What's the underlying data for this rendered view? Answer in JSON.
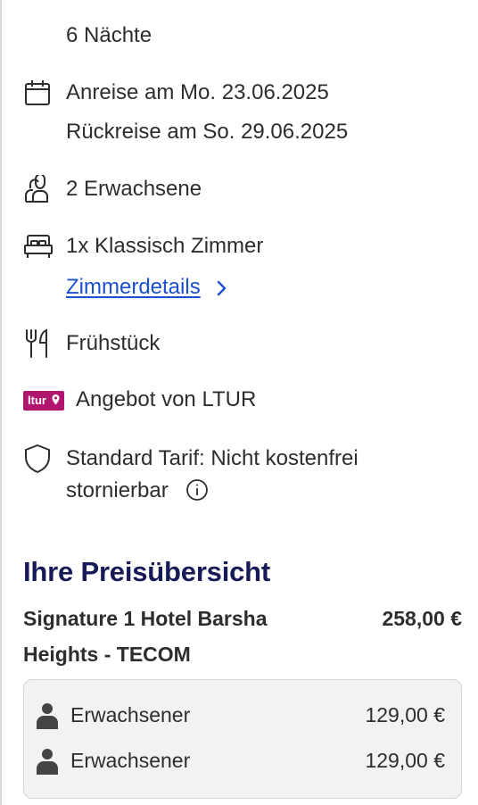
{
  "stay": {
    "nights": "6 Nächte",
    "arrival": "Anreise am Mo. 23.06.2025",
    "departure": "Rückreise am So. 29.06.2025",
    "guests": "2 Erwachsene",
    "room": "1x Klassisch Zimmer",
    "room_details_link": "Zimmerdetails",
    "board": "Frühstück",
    "provider_logo": "ltur",
    "provider": "Angebot von LTUR",
    "tariff_line1": "Standard Tarif: Nicht kostenfrei",
    "tariff_line2": "stornierbar"
  },
  "icons": {
    "calendar": "calendar-icon",
    "guests": "users-icon",
    "room": "bed-icon",
    "board": "fork-knife-icon",
    "tariff": "shield-icon",
    "info": "info-icon",
    "person": "person-icon",
    "chevron": "chevron-right-icon"
  },
  "price_overview": {
    "title": "Ihre Preisübersicht",
    "hotel_name": "Signature 1 Hotel Barsha Heights - TECOM",
    "hotel_total": "258,00 €",
    "rows": [
      {
        "label": "Erwachsener",
        "price": "129,00 €"
      },
      {
        "label": "Erwachsener",
        "price": "129,00 €"
      }
    ]
  },
  "colors": {
    "heading": "#171a56",
    "link": "#1a4fd0",
    "ltur_brand": "#b1166e",
    "text": "#2d2d2d"
  }
}
